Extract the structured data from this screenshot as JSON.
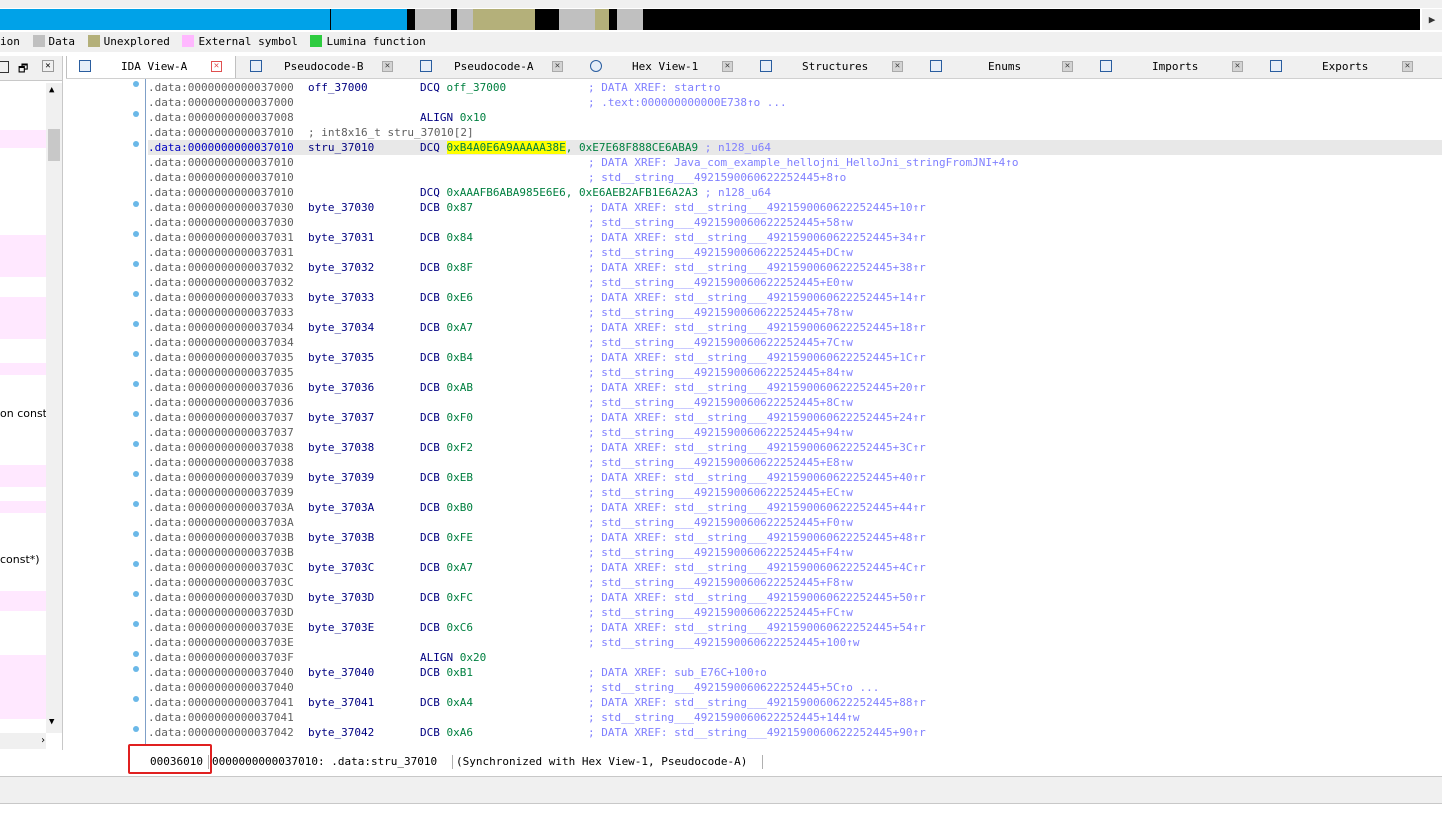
{
  "navband": {
    "colors": {
      "library": "#00a2e8",
      "unexplored": "#b4b07a",
      "data": "#c0c0c0",
      "regular": "#000000"
    }
  },
  "legend": {
    "items": [
      {
        "label": "ion",
        "color": ""
      },
      {
        "label": "Data",
        "color": "#c0c0c0"
      },
      {
        "label": "Unexplored",
        "color": "#b4b07a"
      },
      {
        "label": "External symbol",
        "color": "#ffb8ff"
      },
      {
        "label": "Lumina function",
        "color": "#2ecc40"
      }
    ]
  },
  "left_panel": {
    "fragments": [
      "on const",
      " const*)"
    ]
  },
  "tabs": [
    {
      "label": "IDA View-A",
      "active": true
    },
    {
      "label": "Pseudocode-B",
      "active": false
    },
    {
      "label": "Pseudocode-A",
      "active": false
    },
    {
      "label": "Hex View-1",
      "active": false
    },
    {
      "label": "Structures",
      "active": false
    },
    {
      "label": "Enums",
      "active": false
    },
    {
      "label": "Imports",
      "active": false
    },
    {
      "label": "Exports",
      "active": false
    }
  ],
  "listing": {
    "lines": [
      {
        "addr": ".data:0000000000037000",
        "label": "off_37000",
        "mn": "DCQ",
        "op": "off_37000",
        "comment": "; DATA XREF: start↑o",
        "dot": true
      },
      {
        "addr": ".data:0000000000037000",
        "comment": "; .text:000000000000E738↑o ..."
      },
      {
        "addr": ".data:0000000000037008",
        "mn": "ALIGN",
        "op": "0x10",
        "dot": true
      },
      {
        "addr": ".data:0000000000037010",
        "text": "; int8x16_t stru_37010[2]"
      },
      {
        "addr": ".data:0000000000037010",
        "label": "stru_37010",
        "mn": "DCQ",
        "op_hl": "0xB4A0E6A9AAAAA38E",
        "op_rest": ", 0xE7E68F888CE6ABA9",
        "tail": "; n128_u64",
        "hl": true,
        "dot": true
      },
      {
        "addr": ".data:0000000000037010",
        "comment": "; DATA XREF: Java_com_example_hellojni_HelloJni_stringFromJNI+4↑o"
      },
      {
        "addr": ".data:0000000000037010",
        "comment": "; std__string___4921590060622252445+8↑o"
      },
      {
        "addr": ".data:0000000000037010",
        "mn": "DCQ",
        "op": "0xAAAFB6ABA985E6E6, 0xE6AEB2AFB1E6A2A3",
        "tail": "; n128_u64"
      },
      {
        "addr": ".data:0000000000037030",
        "label": "byte_37030",
        "mn": "DCB",
        "op": "0x87",
        "comment": "; DATA XREF: std__string___4921590060622252445+10↑r",
        "dot": true
      },
      {
        "addr": ".data:0000000000037030",
        "comment": "; std__string___4921590060622252445+58↑w"
      },
      {
        "addr": ".data:0000000000037031",
        "label": "byte_37031",
        "mn": "DCB",
        "op": "0x84",
        "comment": "; DATA XREF: std__string___4921590060622252445+34↑r",
        "dot": true
      },
      {
        "addr": ".data:0000000000037031",
        "comment": "; std__string___4921590060622252445+DC↑w"
      },
      {
        "addr": ".data:0000000000037032",
        "label": "byte_37032",
        "mn": "DCB",
        "op": "0x8F",
        "comment": "; DATA XREF: std__string___4921590060622252445+38↑r",
        "dot": true
      },
      {
        "addr": ".data:0000000000037032",
        "comment": "; std__string___4921590060622252445+E0↑w"
      },
      {
        "addr": ".data:0000000000037033",
        "label": "byte_37033",
        "mn": "DCB",
        "op": "0xE6",
        "comment": "; DATA XREF: std__string___4921590060622252445+14↑r",
        "dot": true
      },
      {
        "addr": ".data:0000000000037033",
        "comment": "; std__string___4921590060622252445+78↑w"
      },
      {
        "addr": ".data:0000000000037034",
        "label": "byte_37034",
        "mn": "DCB",
        "op": "0xA7",
        "comment": "; DATA XREF: std__string___4921590060622252445+18↑r",
        "dot": true
      },
      {
        "addr": ".data:0000000000037034",
        "comment": "; std__string___4921590060622252445+7C↑w"
      },
      {
        "addr": ".data:0000000000037035",
        "label": "byte_37035",
        "mn": "DCB",
        "op": "0xB4",
        "comment": "; DATA XREF: std__string___4921590060622252445+1C↑r",
        "dot": true
      },
      {
        "addr": ".data:0000000000037035",
        "comment": "; std__string___4921590060622252445+84↑w"
      },
      {
        "addr": ".data:0000000000037036",
        "label": "byte_37036",
        "mn": "DCB",
        "op": "0xAB",
        "comment": "; DATA XREF: std__string___4921590060622252445+20↑r",
        "dot": true
      },
      {
        "addr": ".data:0000000000037036",
        "comment": "; std__string___4921590060622252445+8C↑w"
      },
      {
        "addr": ".data:0000000000037037",
        "label": "byte_37037",
        "mn": "DCB",
        "op": "0xF0",
        "comment": "; DATA XREF: std__string___4921590060622252445+24↑r",
        "dot": true
      },
      {
        "addr": ".data:0000000000037037",
        "comment": "; std__string___4921590060622252445+94↑w"
      },
      {
        "addr": ".data:0000000000037038",
        "label": "byte_37038",
        "mn": "DCB",
        "op": "0xF2",
        "comment": "; DATA XREF: std__string___4921590060622252445+3C↑r",
        "dot": true
      },
      {
        "addr": ".data:0000000000037038",
        "comment": "; std__string___4921590060622252445+E8↑w"
      },
      {
        "addr": ".data:0000000000037039",
        "label": "byte_37039",
        "mn": "DCB",
        "op": "0xEB",
        "comment": "; DATA XREF: std__string___4921590060622252445+40↑r",
        "dot": true
      },
      {
        "addr": ".data:0000000000037039",
        "comment": "; std__string___4921590060622252445+EC↑w"
      },
      {
        "addr": ".data:000000000003703A",
        "label": "byte_3703A",
        "mn": "DCB",
        "op": "0xB0",
        "comment": "; DATA XREF: std__string___4921590060622252445+44↑r",
        "dot": true
      },
      {
        "addr": ".data:000000000003703A",
        "comment": "; std__string___4921590060622252445+F0↑w"
      },
      {
        "addr": ".data:000000000003703B",
        "label": "byte_3703B",
        "mn": "DCB",
        "op": "0xFE",
        "comment": "; DATA XREF: std__string___4921590060622252445+48↑r",
        "dot": true
      },
      {
        "addr": ".data:000000000003703B",
        "comment": "; std__string___4921590060622252445+F4↑w"
      },
      {
        "addr": ".data:000000000003703C",
        "label": "byte_3703C",
        "mn": "DCB",
        "op": "0xA7",
        "comment": "; DATA XREF: std__string___4921590060622252445+4C↑r",
        "dot": true
      },
      {
        "addr": ".data:000000000003703C",
        "comment": "; std__string___4921590060622252445+F8↑w"
      },
      {
        "addr": ".data:000000000003703D",
        "label": "byte_3703D",
        "mn": "DCB",
        "op": "0xFC",
        "comment": "; DATA XREF: std__string___4921590060622252445+50↑r",
        "dot": true
      },
      {
        "addr": ".data:000000000003703D",
        "comment": "; std__string___4921590060622252445+FC↑w"
      },
      {
        "addr": ".data:000000000003703E",
        "label": "byte_3703E",
        "mn": "DCB",
        "op": "0xC6",
        "comment": "; DATA XREF: std__string___4921590060622252445+54↑r",
        "dot": true
      },
      {
        "addr": ".data:000000000003703E",
        "comment": "; std__string___4921590060622252445+100↑w"
      },
      {
        "addr": ".data:000000000003703F",
        "mn": "ALIGN",
        "op": "0x20",
        "dot": true
      },
      {
        "addr": ".data:0000000000037040",
        "label": "byte_37040",
        "mn": "DCB",
        "op": "0xB1",
        "comment": "; DATA XREF: sub_E76C+100↑o",
        "dot": true
      },
      {
        "addr": ".data:0000000000037040",
        "comment": "; std__string___4921590060622252445+5C↑o ..."
      },
      {
        "addr": ".data:0000000000037041",
        "label": "byte_37041",
        "mn": "DCB",
        "op": "0xA4",
        "comment": "; DATA XREF: std__string___4921590060622252445+88↑r",
        "dot": true
      },
      {
        "addr": ".data:0000000000037041",
        "comment": "; std__string___4921590060622252445+144↑w"
      },
      {
        "addr": ".data:0000000000037042",
        "label": "byte_37042",
        "mn": "DCB",
        "op": "0xA6",
        "comment": "; DATA XREF: std__string___4921590060622252445+90↑r",
        "dot": true
      }
    ]
  },
  "status": {
    "offset": "00036010",
    "address": "0000000000037010: .data:stru_37010",
    "sync": "(Synchronized with Hex View-1, Pseudocode-A)"
  }
}
